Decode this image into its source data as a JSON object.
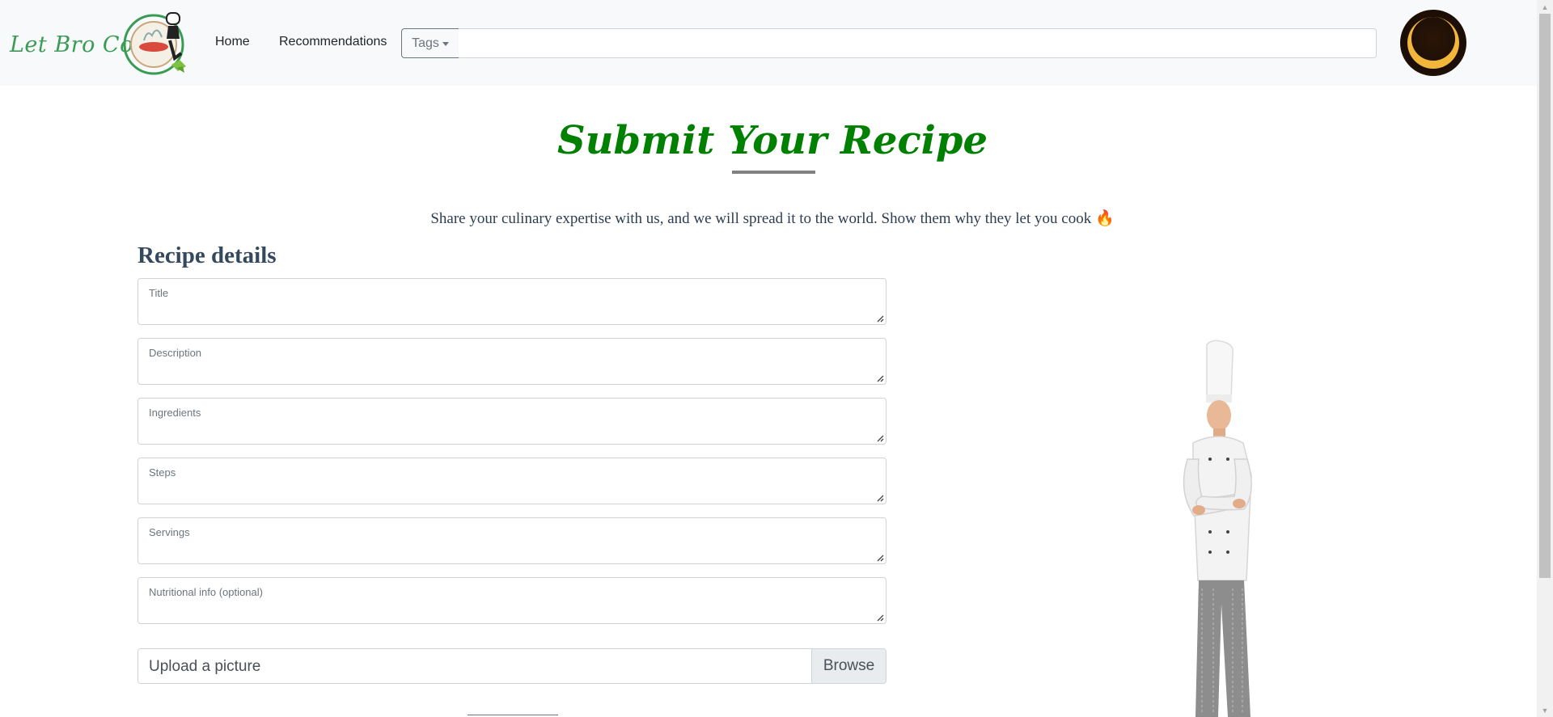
{
  "navbar": {
    "logo_text": "Let Bro Cook",
    "links": {
      "home": "Home",
      "recommendations": "Recommendations"
    },
    "tags_label": "Tags",
    "search_value": "",
    "search_placeholder": "",
    "theme_toggle_icon": "crescent-moon-icon"
  },
  "header": {
    "title": "Submit Your Recipe",
    "subtitle": "Share your culinary expertise with us, and we will spread it to the world. Show them why they let you cook",
    "subtitle_emoji": "🔥"
  },
  "form": {
    "heading": "Recipe details",
    "fields": {
      "title": {
        "label": "Title",
        "value": ""
      },
      "description": {
        "label": "Description",
        "value": ""
      },
      "ingredients": {
        "label": "Ingredients",
        "value": ""
      },
      "steps": {
        "label": "Steps",
        "value": ""
      },
      "servings": {
        "label": "Servings",
        "value": ""
      },
      "nutritional": {
        "label": "Nutritional info (optional)",
        "value": ""
      }
    },
    "upload": {
      "label": "Upload a picture",
      "browse_label": "Browse"
    }
  },
  "colors": {
    "title_green": "#008000",
    "logo_green": "#3a9b55",
    "navbar_bg": "#f8f9fa",
    "underline_gray": "#808080"
  }
}
